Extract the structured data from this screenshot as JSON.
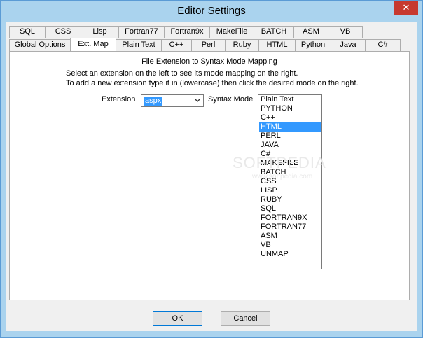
{
  "window": {
    "title": "Editor Settings",
    "close_glyph": "✕"
  },
  "tabs_row1": [
    "SQL",
    "CSS",
    "Lisp",
    "Fortran77",
    "Fortran9x",
    "MakeFile",
    "BATCH",
    "ASM",
    "VB"
  ],
  "tabs_row2": [
    "Global Options",
    "Ext. Map",
    "Plain Text",
    "C++",
    "Perl",
    "Ruby",
    "HTML",
    "Python",
    "Java",
    "C#"
  ],
  "active_tab": "Ext. Map",
  "panel": {
    "title": "File Extension to Syntax Mode Mapping",
    "help_line1": "Select an extension on the left to see its mode mapping on the right.",
    "help_line2": "To add a new extension type it in (lowercase) then click the desired mode on the right.",
    "extension_label": "Extension",
    "extension_value": "aspx",
    "syntax_mode_label": "Syntax Mode",
    "modes": [
      "Plain Text",
      "PYTHON",
      "C++",
      "HTML",
      "PERL",
      "JAVA",
      "C#",
      "MAKEFILE",
      "BATCH",
      "CSS",
      "LISP",
      "RUBY",
      "SQL",
      "FORTRAN9X",
      "FORTRAN77",
      "ASM",
      "VB",
      "UNMAP"
    ],
    "selected_mode": "HTML"
  },
  "watermark": {
    "text": "SOFTPEDIA",
    "sub": "www.softpedia.com"
  },
  "buttons": {
    "ok": "OK",
    "cancel": "Cancel"
  },
  "colors": {
    "selection": "#3399ff",
    "close": "#c7392f",
    "frame": "#aad3ee"
  }
}
